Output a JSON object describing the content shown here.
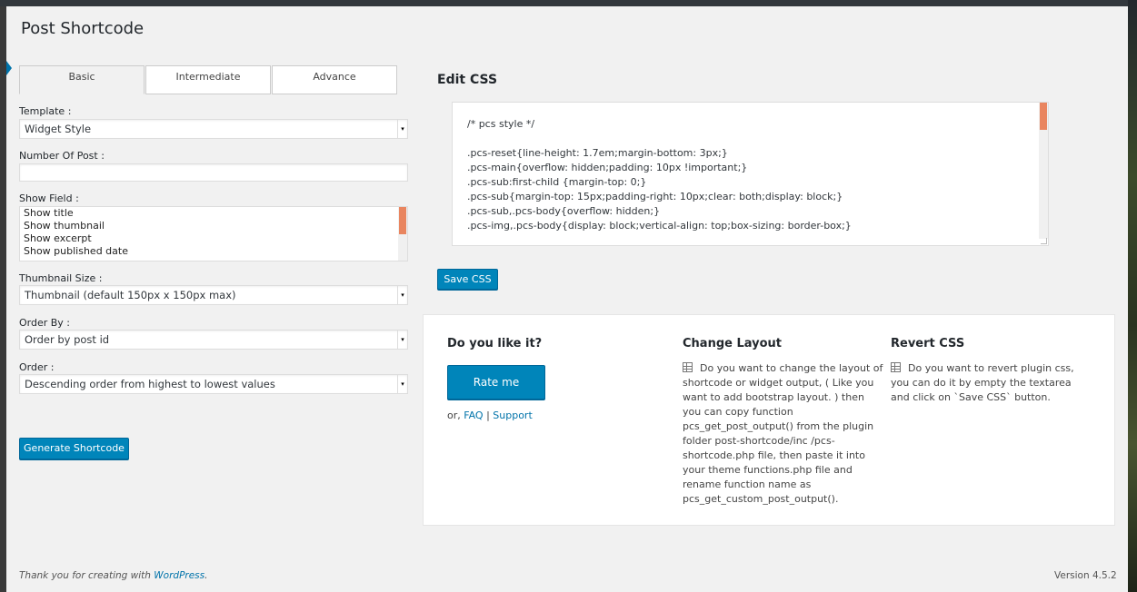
{
  "page": {
    "title": "Post Shortcode"
  },
  "tabs": [
    {
      "label": "Basic",
      "active": true
    },
    {
      "label": "Intermediate",
      "active": false
    },
    {
      "label": "Advance",
      "active": false
    }
  ],
  "form": {
    "template": {
      "label": "Template :",
      "value": "Widget Style"
    },
    "number_of_post": {
      "label": "Number Of Post :",
      "value": ""
    },
    "show_field": {
      "label": "Show Field :",
      "options": [
        "Show title",
        "Show thumbnail",
        "Show excerpt",
        "Show published date"
      ]
    },
    "thumbnail_size": {
      "label": "Thumbnail Size :",
      "value": "Thumbnail (default 150px x 150px max)"
    },
    "order_by": {
      "label": "Order By :",
      "value": "Order by post id"
    },
    "order": {
      "label": "Order :",
      "value": "Descending order from highest to lowest values"
    },
    "generate_button": "Generate Shortcode"
  },
  "edit_css": {
    "title": "Edit CSS",
    "code": "/* pcs style */\n\n.pcs-reset{line-height: 1.7em;margin-bottom: 3px;}\n.pcs-main{overflow: hidden;padding: 10px !important;}\n.pcs-sub:first-child {margin-top: 0;}\n.pcs-sub{margin-top: 15px;padding-right: 10px;clear: both;display: block;}\n.pcs-sub,.pcs-body{overflow: hidden;}\n.pcs-img,.pcs-body{display: block;vertical-align: top;box-sizing: border-box;}",
    "save_button": "Save CSS"
  },
  "info": {
    "like": {
      "title": "Do you like it?",
      "rate_button": "Rate me",
      "or_text": "or,",
      "faq_link": "FAQ",
      "separator": "|",
      "support_link": "Support"
    },
    "change_layout": {
      "title": "Change Layout",
      "text": "Do you want to change the layout of shortcode or widget output, ( Like you want to add bootstrap layout. ) then you can copy function pcs_get_post_output() from the plugin folder post-shortcode/inc /pcs-shortcode.php file, then paste it into your theme functions.php file and rename function name as pcs_get_custom_post_output()."
    },
    "revert_css": {
      "title": "Revert CSS",
      "text": "Do you want to revert plugin css, you can do it by empty the textarea and click on `Save CSS` button."
    }
  },
  "footer": {
    "thanks_text": "Thank you for creating with",
    "wordpress_link": "WordPress",
    "thanks_suffix": ".",
    "version": "Version 4.5.2"
  },
  "colors": {
    "primary": "#0085ba",
    "link": "#0073aa",
    "scroll_thumb": "#e9855f",
    "background": "#f1f1f1"
  }
}
